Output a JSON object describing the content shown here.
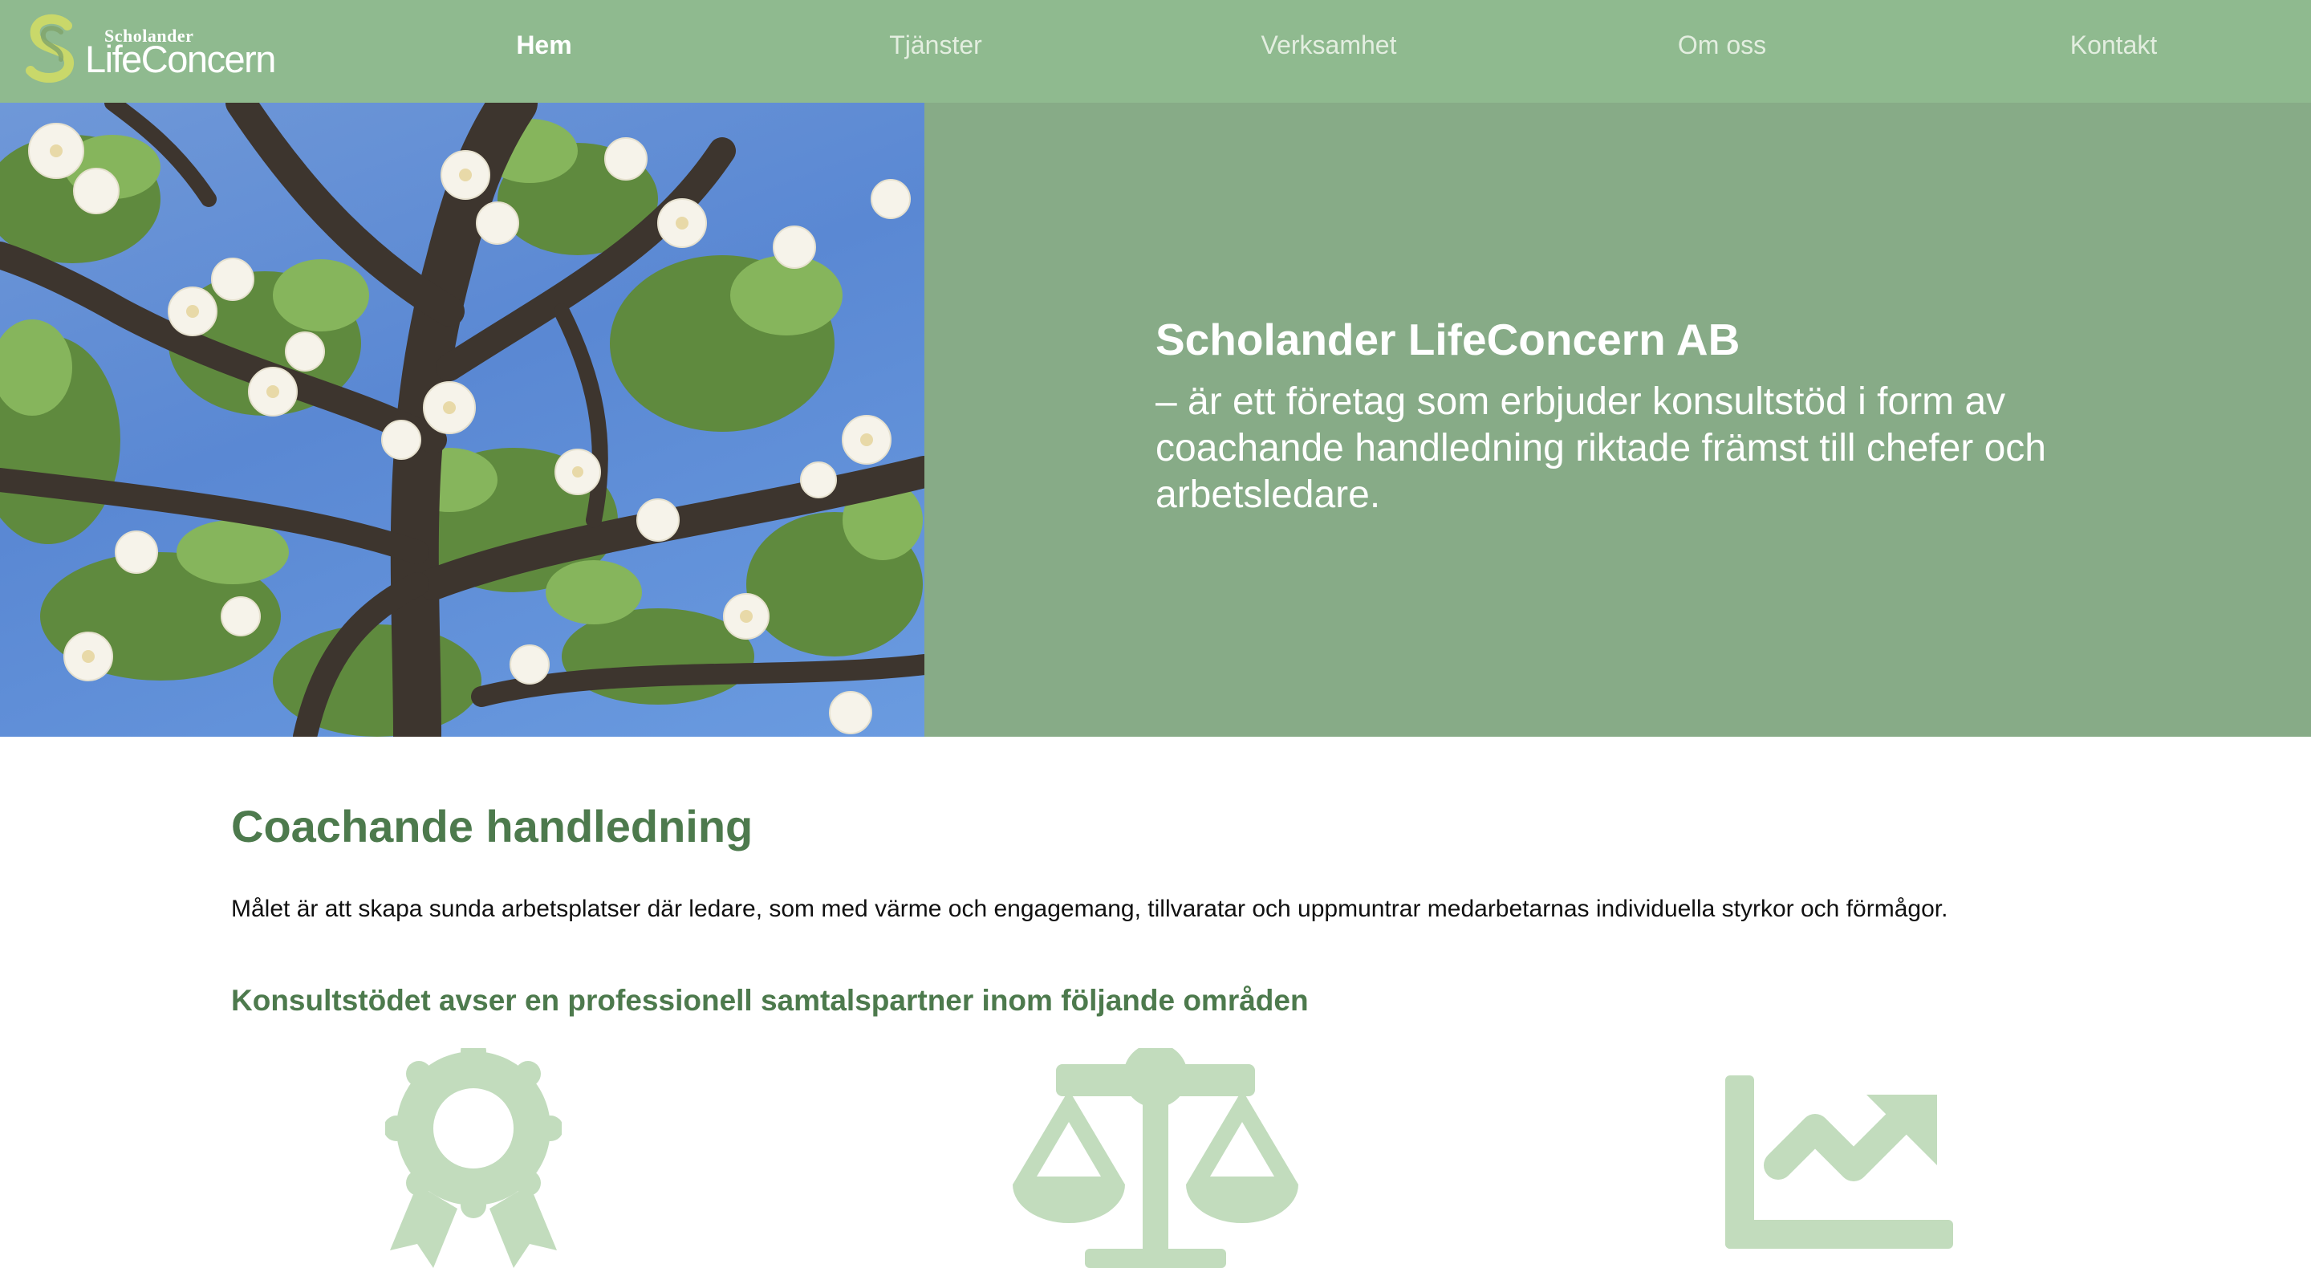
{
  "header": {
    "logo": {
      "small": "Scholander",
      "big": "LifeConcern"
    },
    "nav": [
      {
        "label": "Hem",
        "active": true
      },
      {
        "label": "Tjänster",
        "active": false
      },
      {
        "label": "Verksamhet",
        "active": false
      },
      {
        "label": "Om oss",
        "active": false
      },
      {
        "label": "Kontakt",
        "active": false
      }
    ]
  },
  "hero": {
    "image": "apple-blossom-photo",
    "title": "Scholander LifeConcern AB",
    "text": "– är ett företag som erbjuder konsultstöd i form av coachande handledning riktade främst till chefer och arbetsledare."
  },
  "content": {
    "title": "Coachande handledning",
    "intro": "Målet är att skapa sunda arbetsplatser där ledare, som med värme och engagemang, tillvaratar och uppmuntrar medarbetarnas individuella styrkor och förmågor.",
    "subtitle": "Konsultstödet avser en professionell samtalspartner inom följande områden",
    "features": [
      {
        "icon": "award-ribbon-icon"
      },
      {
        "icon": "balance-scale-icon"
      },
      {
        "icon": "growth-chart-icon"
      }
    ]
  },
  "colors": {
    "header_bg": "#8fba8f",
    "hero_panel_bg": "#87ab87",
    "accent_green": "#4d7a4d",
    "icon_green": "#c2dcbd"
  }
}
